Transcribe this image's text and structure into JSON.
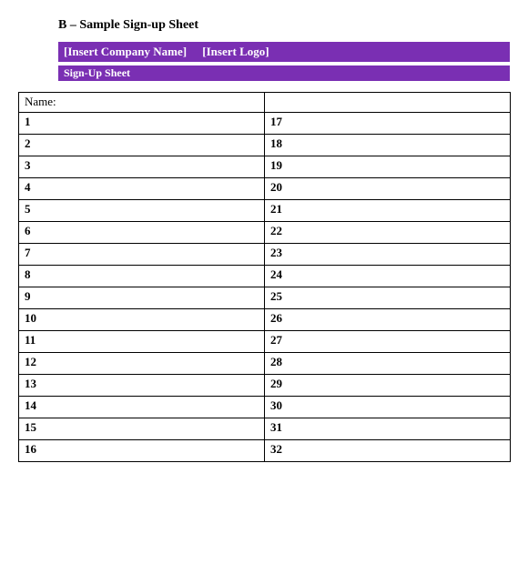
{
  "title": "B – Sample Sign-up Sheet",
  "header_bar": {
    "company_placeholder": "[Insert Company Name]",
    "logo_placeholder": "[Insert Logo]"
  },
  "subheader_bar": "Sign-Up Sheet",
  "table": {
    "name_label": "Name:",
    "rows": [
      {
        "left": "1",
        "right": "17"
      },
      {
        "left": "2",
        "right": "18"
      },
      {
        "left": "3",
        "right": "19"
      },
      {
        "left": "4",
        "right": "20"
      },
      {
        "left": "5",
        "right": "21"
      },
      {
        "left": "6",
        "right": "22"
      },
      {
        "left": "7",
        "right": "23"
      },
      {
        "left": "8",
        "right": "24"
      },
      {
        "left": "9",
        "right": "25"
      },
      {
        "left": "10",
        "right": "26"
      },
      {
        "left": "11",
        "right": "27"
      },
      {
        "left": "12",
        "right": "28"
      },
      {
        "left": "13",
        "right": "29"
      },
      {
        "left": "14",
        "right": "30"
      },
      {
        "left": "15",
        "right": "31"
      },
      {
        "left": "16",
        "right": "32"
      }
    ]
  }
}
